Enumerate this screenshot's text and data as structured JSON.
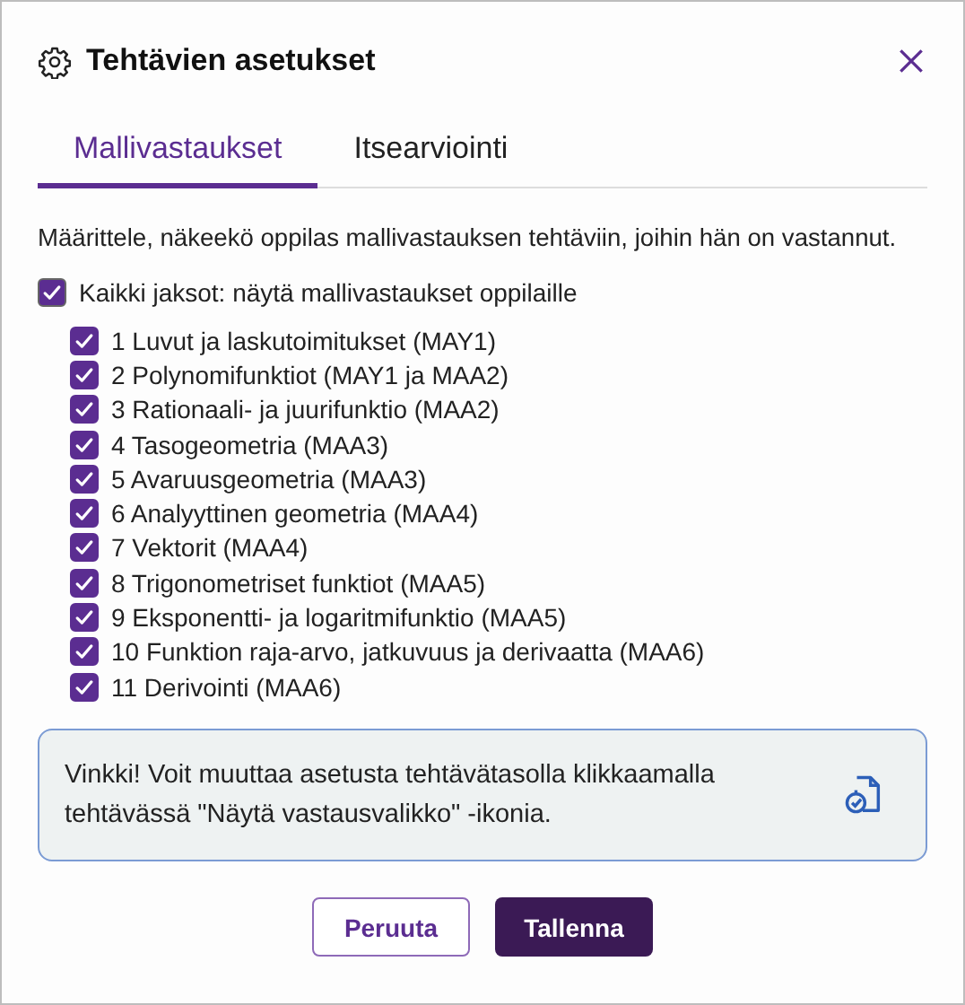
{
  "dialog": {
    "title": "Tehtävien asetukset"
  },
  "tabs": [
    {
      "label": "Mallivastaukset",
      "selected": true
    },
    {
      "label": "Itsearviointi",
      "selected": false
    }
  ],
  "description": "Määrittele, näkeekö oppilas mallivastauksen tehtäviin, joihin hän on vastannut.",
  "all_sections": {
    "label": "Kaikki jaksot: näytä mallivastaukset oppilaille",
    "checked": true
  },
  "sections": [
    {
      "label": "1 Luvut ja laskutoimitukset (MAY1)",
      "checked": true
    },
    {
      "label": "2 Polynomifunktiot (MAY1 ja MAA2)",
      "checked": true
    },
    {
      "label": "3 Rationaali- ja juurifunktio (MAA2)",
      "checked": true
    },
    {
      "label": "4 Tasogeometria (MAA3)",
      "checked": true
    },
    {
      "label": "5 Avaruusgeometria (MAA3)",
      "checked": true
    },
    {
      "label": "6 Analyyttinen geometria (MAA4)",
      "checked": true
    },
    {
      "label": "7 Vektorit (MAA4)",
      "checked": true
    },
    {
      "label": "8 Trigonometriset funktiot (MAA5)",
      "checked": true
    },
    {
      "label": "9 Eksponentti- ja logaritmifunktio (MAA5)",
      "checked": true
    },
    {
      "label": "10 Funktion raja-arvo, jatkuvuus ja derivaatta (MAA6)",
      "checked": true
    },
    {
      "label": "11 Derivointi (MAA6)",
      "checked": true
    }
  ],
  "tip": "Vinkki! Voit muuttaa asetusta tehtävätasolla klikkaamalla tehtävässä \"Näytä vastausvalikko\" -ikonia.",
  "buttons": [
    {
      "label": "Peruuta",
      "kind": "secondary"
    },
    {
      "label": "Tallenna",
      "kind": "primary"
    }
  ]
}
